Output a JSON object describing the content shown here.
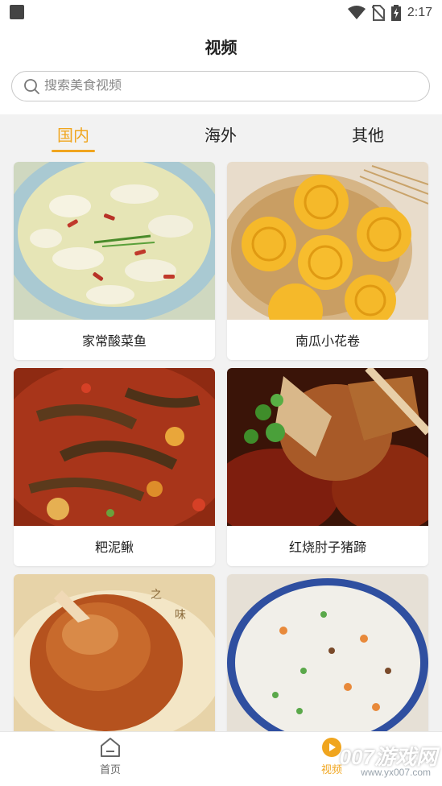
{
  "status_bar": {
    "time": "2:17"
  },
  "header": {
    "title": "视频"
  },
  "search": {
    "placeholder": "搜索美食视频"
  },
  "tabs": [
    {
      "label": "国内",
      "active": true
    },
    {
      "label": "海外",
      "active": false
    },
    {
      "label": "其他",
      "active": false
    }
  ],
  "videos": [
    {
      "title": "家常酸菜鱼"
    },
    {
      "title": "南瓜小花卷"
    },
    {
      "title": "粑泥鳅"
    },
    {
      "title": "红烧肘子猪蹄"
    },
    {
      "title": ""
    },
    {
      "title": ""
    }
  ],
  "bottom_nav": [
    {
      "label": "首页",
      "icon": "home-icon",
      "active": false
    },
    {
      "label": "视频",
      "icon": "video-play-icon",
      "active": true
    }
  ],
  "watermark": {
    "main": "007游戏网",
    "sub": "www.yx007.com"
  },
  "colors": {
    "accent": "#f0a51e",
    "background": "#f2f2f2"
  }
}
